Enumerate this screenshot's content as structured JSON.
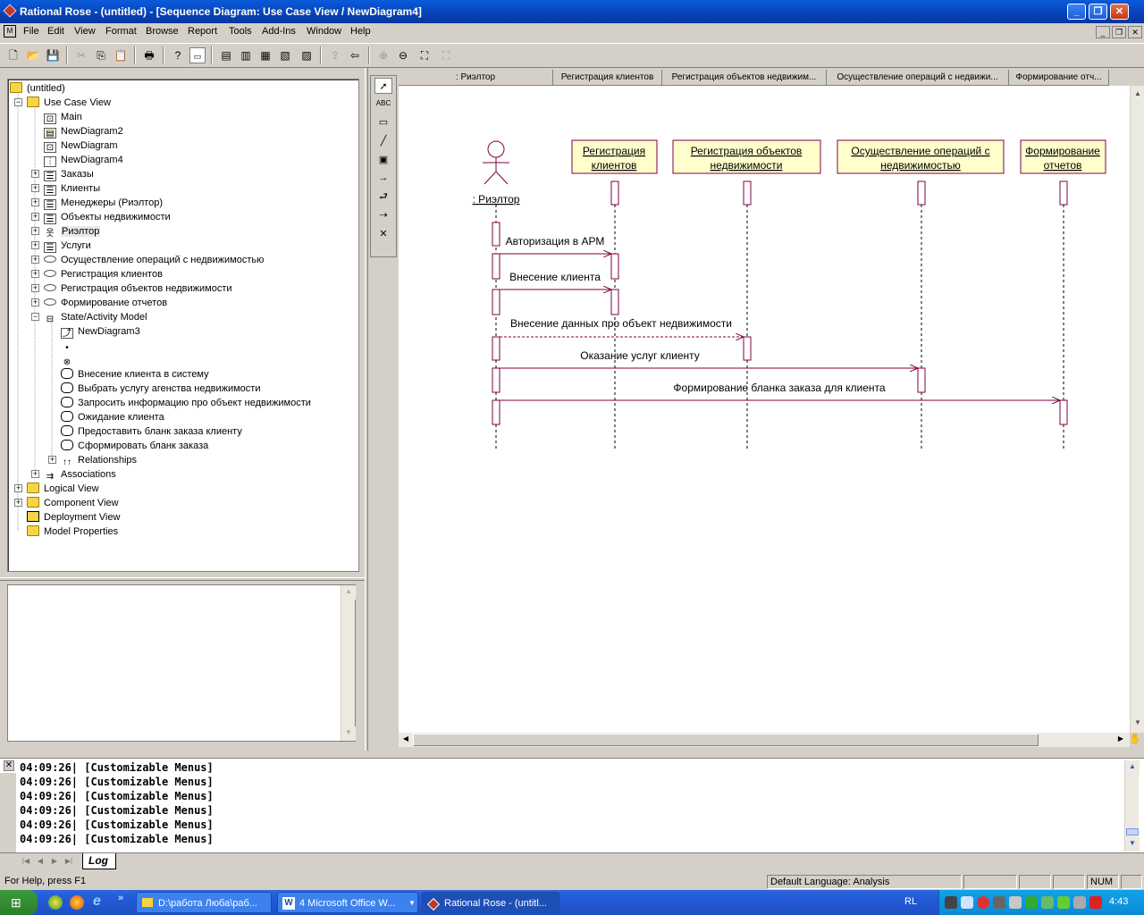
{
  "window": {
    "title": "Rational Rose - (untitled) - [Sequence Diagram: Use Case View / NewDiagram4]"
  },
  "menu": [
    "File",
    "Edit",
    "View",
    "Format",
    "Browse",
    "Report",
    "Tools",
    "Add-Ins",
    "Window",
    "Help"
  ],
  "browser": {
    "root": "(untitled)",
    "use_case_view": "Use Case View",
    "items": {
      "main": "Main",
      "newdiagram2": "NewDiagram2",
      "newdiagram": "NewDiagram",
      "newdiagram4": "NewDiagram4",
      "zakazy": "Заказы",
      "klienty": "Клиенты",
      "menedzhery": "Менеджеры (Риэлтор)",
      "obekty": "Объекты недвижимости",
      "rieltor": "Риэлтор",
      "uslugi": "Услуги",
      "uc_osush": "Осуществление операций с недвижимостью",
      "uc_reg_klient": "Регистрация клиентов",
      "uc_reg_obekt": "Регистрация объектов недвижимости",
      "uc_form": "Формирование отчетов",
      "state_model": "State/Activity Model",
      "newdiagram3": "NewDiagram3",
      "act1": "Внесение клиента в систему",
      "act2": "Выбрать услугу агенства недвижимости",
      "act3": "Запросить информацию про объект недвижимости",
      "act4": "Ожидание клиента",
      "act5": "Предоставить бланк заказа клиенту",
      "act6": "Сформировать бланк заказа",
      "relationships": "Relationships",
      "associations": "Associations",
      "logical_view": "Logical View",
      "component_view": "Component View",
      "deployment_view": "Deployment View",
      "model_properties": "Model Properties"
    }
  },
  "diagram": {
    "headers": [
      ": Риэлтор",
      "Регистрация клиентов",
      "Регистрация объектов недвижим...",
      "Осуществление операций с недвижи...",
      "Формирование отч..."
    ],
    "actor_label": ": Риэлтор",
    "objects": [
      [
        "Регистрация",
        "клиентов"
      ],
      [
        "Регистрация объектов",
        "недвижимости"
      ],
      [
        "Осуществление операций с",
        "недвижимостью"
      ],
      [
        "Формирование",
        "отчетов"
      ]
    ],
    "messages": [
      "Авторизация в АРМ",
      "Внесение клиента",
      "Внесение данных про объект недвижимости",
      "Оказание услуг клиенту",
      "Формирование бланка заказа для клиента"
    ]
  },
  "log": {
    "lines": [
      "04:09:26|  [Customizable Menus]",
      "04:09:26|  [Customizable Menus]",
      "04:09:26|  [Customizable Menus]",
      "04:09:26|  [Customizable Menus]",
      "04:09:26|  [Customizable Menus]",
      "04:09:26|  [Customizable Menus]"
    ],
    "tab": "Log"
  },
  "status": {
    "help": "For Help, press F1",
    "language": "Default Language: Analysis",
    "num": "NUM"
  },
  "taskbar": {
    "tasks": [
      "D:\\работа Люба\\раб...",
      "4 Microsoft Office W...",
      "Rational Rose - (untitl..."
    ],
    "lang": "RL",
    "clock": "4:43"
  }
}
